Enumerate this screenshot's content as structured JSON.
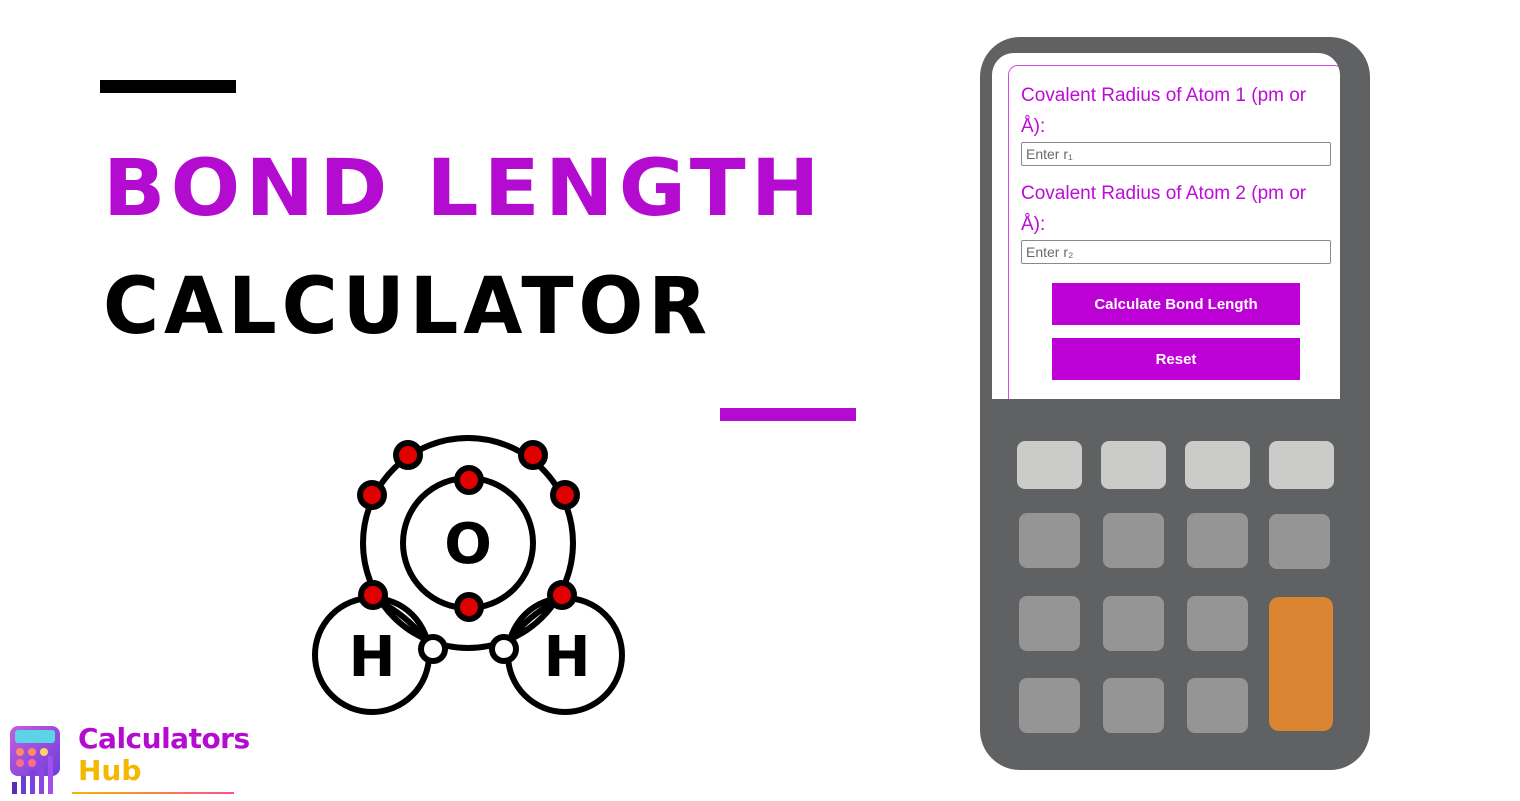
{
  "title": {
    "line1": "BOND LENGTH",
    "line2": "CALCULATOR"
  },
  "colors": {
    "accent": "#b40bd1",
    "button": "#bd00d6",
    "calculator_body": "#606163",
    "key_light": "#cbcbc9",
    "key_mid": "#959595",
    "key_equals": "#d98531"
  },
  "molecule": {
    "center_atom": "O",
    "left_atom": "H",
    "right_atom": "H",
    "icon": "water-molecule-icon"
  },
  "calculator": {
    "fields": [
      {
        "label": "Covalent Radius of Atom 1 (pm or Å):",
        "placeholder": "Enter r₁",
        "value": ""
      },
      {
        "label": "Covalent Radius of Atom 2 (pm or Å):",
        "placeholder": "Enter r₂",
        "value": ""
      }
    ],
    "buttons": {
      "calculate": "Calculate Bond Length",
      "reset": "Reset"
    }
  },
  "logo": {
    "line1": "Calculators",
    "line2": "Hub"
  }
}
